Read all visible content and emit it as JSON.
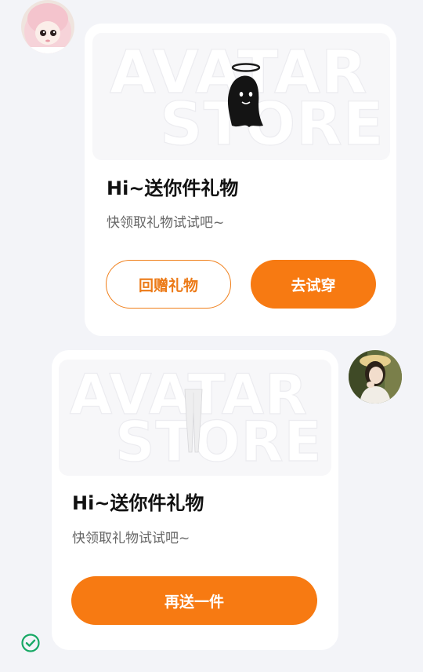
{
  "messages": [
    {
      "side": "incoming",
      "avatar_icon": "doll-avatar-icon",
      "gift_icon": "ghost-halo-icon",
      "watermark": [
        "AVATAR",
        "STORE"
      ],
      "title": "Hi~送你件礼物",
      "subtitle": "快领取礼物试试吧~",
      "buttons": {
        "return_gift": "回赠礼物",
        "try_on": "去试穿"
      }
    },
    {
      "side": "outgoing",
      "avatar_icon": "photo-avatar-icon",
      "gift_icon": "white-leggings-icon",
      "watermark": [
        "AVATAR",
        "STORE"
      ],
      "title": "Hi~送你件礼物",
      "subtitle": "快领取礼物试试吧~",
      "buttons": {
        "send_again": "再送一件"
      },
      "status_icon": "delivered-check-icon"
    }
  ],
  "colors": {
    "accent": "#f77a12",
    "background": "#f3f4f8",
    "check": "#17a865"
  }
}
